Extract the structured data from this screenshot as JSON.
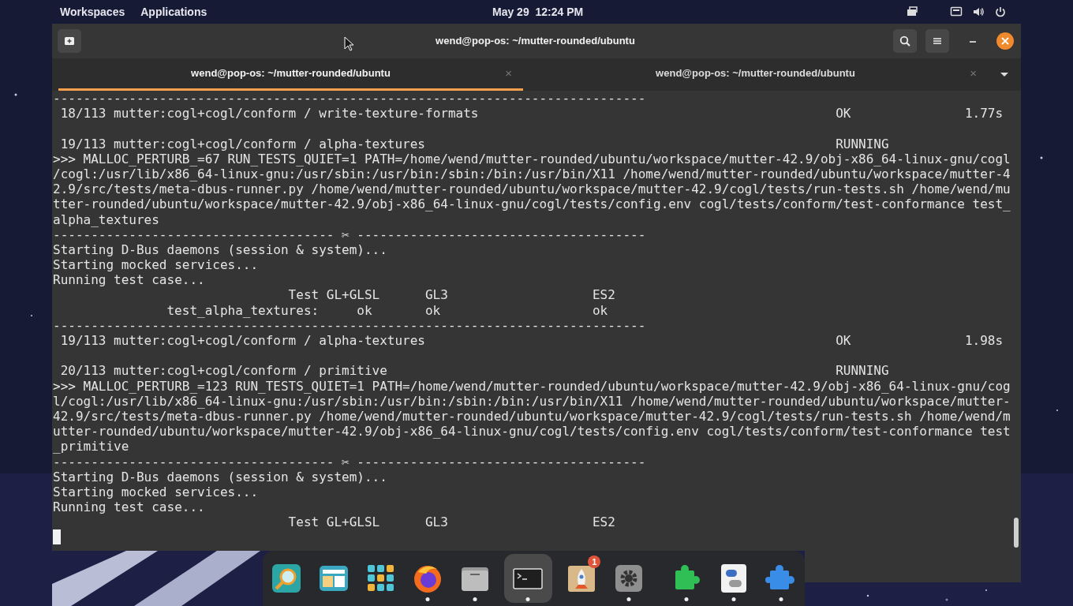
{
  "top_bar": {
    "menus": [
      "Workspaces",
      "Applications"
    ],
    "date": "May 29",
    "time": "12:24 PM"
  },
  "window": {
    "title": "wend@pop-os: ~/mutter-rounded/ubuntu"
  },
  "tabs": [
    {
      "label": "wend@pop-os: ~/mutter-rounded/ubuntu",
      "close": "×",
      "selected": true
    },
    {
      "label": "wend@pop-os: ~/mutter-rounded/ubuntu",
      "close": "×",
      "selected": false
    }
  ],
  "terminal": {
    "lines": [
      {
        "kind": "text",
        "text": "------------------------------------------------------------------------------"
      },
      {
        "kind": "result",
        "test": "18/113 mutter:cogl+cogl/conform / write-texture-formats",
        "status": "OK",
        "time": "1.77s"
      },
      {
        "kind": "blank"
      },
      {
        "kind": "result",
        "test": "19/113 mutter:cogl+cogl/conform / alpha-textures",
        "status": "RUNNING"
      },
      {
        "kind": "text",
        "text": ">>> MALLOC_PERTURB_=67 RUN_TESTS_QUIET=1 PATH=/home/wend/mutter-rounded/ubuntu/workspace/mutter-42.9/obj-x86_64-linux-gnu/cogl"
      },
      {
        "kind": "text",
        "text": "/cogl:/usr/lib/x86_64-linux-gnu:/usr/sbin:/usr/bin:/sbin:/bin:/usr/bin/X11 /home/wend/mutter-rounded/ubuntu/workspace/mutter-4"
      },
      {
        "kind": "text",
        "text": "2.9/src/tests/meta-dbus-runner.py /home/wend/mutter-rounded/ubuntu/workspace/mutter-42.9/cogl/tests/run-tests.sh /home/wend/mu"
      },
      {
        "kind": "text",
        "text": "tter-rounded/ubuntu/workspace/mutter-42.9/obj-x86_64-linux-gnu/cogl/tests/config.env cogl/tests/conform/test-conformance test_"
      },
      {
        "kind": "text",
        "text": "alpha_textures"
      },
      {
        "kind": "text",
        "text": "------------------------------------- ✂ --------------------------------------"
      },
      {
        "kind": "text",
        "text": "Starting D-Bus daemons (session & system)..."
      },
      {
        "kind": "text",
        "text": "Starting mocked services..."
      },
      {
        "kind": "text",
        "text": "Running test case..."
      },
      {
        "kind": "table_header",
        "label": "Test",
        "columns": [
          "GL+GLSL",
          "GL3",
          "ES2"
        ]
      },
      {
        "kind": "table_row",
        "label": "test_alpha_textures:",
        "values": [
          "ok",
          "ok",
          "ok"
        ]
      },
      {
        "kind": "text",
        "text": "------------------------------------------------------------------------------"
      },
      {
        "kind": "result",
        "test": "19/113 mutter:cogl+cogl/conform / alpha-textures",
        "status": "OK",
        "time": "1.98s"
      },
      {
        "kind": "blank"
      },
      {
        "kind": "result",
        "test": "20/113 mutter:cogl+cogl/conform / primitive",
        "status": "RUNNING"
      },
      {
        "kind": "text",
        "text": ">>> MALLOC_PERTURB_=123 RUN_TESTS_QUIET=1 PATH=/home/wend/mutter-rounded/ubuntu/workspace/mutter-42.9/obj-x86_64-linux-gnu/cog"
      },
      {
        "kind": "text",
        "text": "l/cogl:/usr/lib/x86_64-linux-gnu:/usr/sbin:/usr/bin:/sbin:/bin:/usr/bin/X11 /home/wend/mutter-rounded/ubuntu/workspace/mutter-"
      },
      {
        "kind": "text",
        "text": "42.9/src/tests/meta-dbus-runner.py /home/wend/mutter-rounded/ubuntu/workspace/mutter-42.9/cogl/tests/run-tests.sh /home/wend/m"
      },
      {
        "kind": "text",
        "text": "utter-rounded/ubuntu/workspace/mutter-42.9/obj-x86_64-linux-gnu/cogl/tests/config.env cogl/tests/conform/test-conformance test"
      },
      {
        "kind": "text",
        "text": "_primitive"
      },
      {
        "kind": "text",
        "text": "------------------------------------- ✂ --------------------------------------"
      },
      {
        "kind": "text",
        "text": "Starting D-Bus daemons (session & system)..."
      },
      {
        "kind": "text",
        "text": "Starting mocked services..."
      },
      {
        "kind": "text",
        "text": "Running test case..."
      },
      {
        "kind": "table_header",
        "label": "Test",
        "columns": [
          "GL+GLSL",
          "GL3",
          "ES2"
        ]
      },
      {
        "kind": "cursor"
      }
    ]
  },
  "dock": [
    {
      "kind": "search",
      "running": false,
      "selected": false
    },
    {
      "kind": "windows",
      "running": false,
      "selected": false
    },
    {
      "kind": "apps",
      "running": false,
      "selected": false
    },
    {
      "kind": "browser",
      "running": true,
      "selected": false
    },
    {
      "kind": "files",
      "running": true,
      "selected": false
    },
    {
      "kind": "terminal",
      "running": true,
      "selected": true
    },
    {
      "kind": "rocket",
      "running": false,
      "selected": false,
      "badge": "1"
    },
    {
      "kind": "gear",
      "running": true,
      "selected": false
    },
    {
      "kind": "puzzle_green",
      "running": true,
      "selected": false
    },
    {
      "kind": "toggle",
      "running": true,
      "selected": false
    },
    {
      "kind": "puzzle_blue",
      "running": true,
      "selected": false
    }
  ]
}
